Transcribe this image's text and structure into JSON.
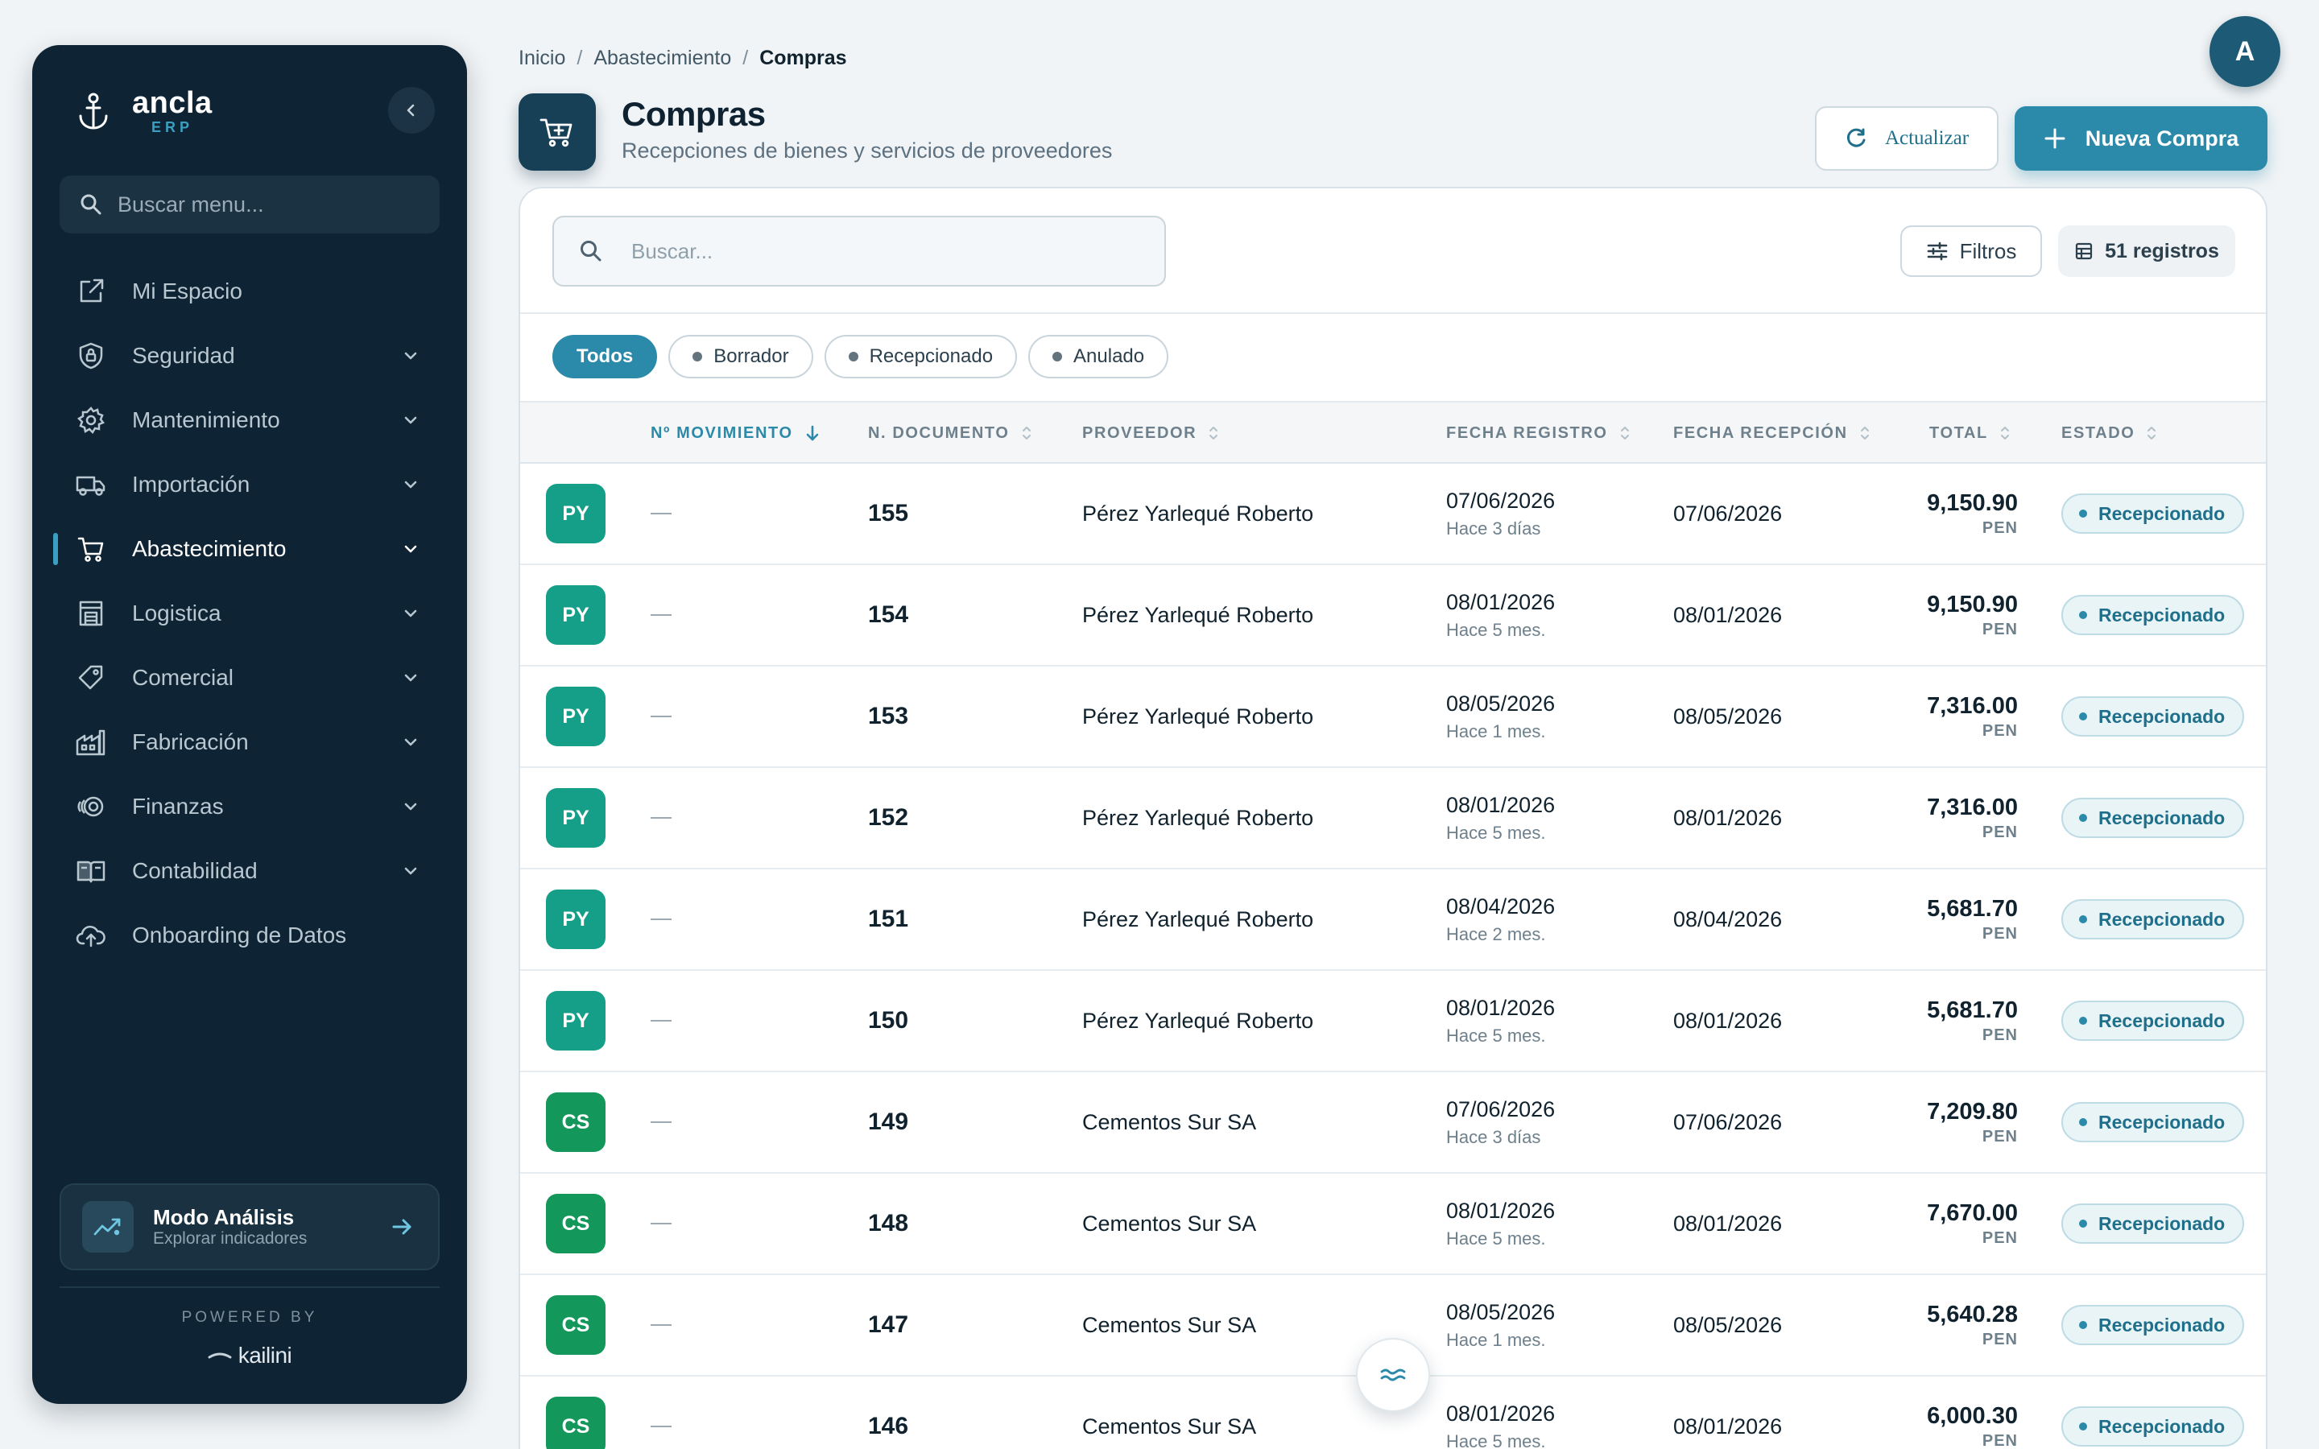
{
  "brand": {
    "name": "ancla",
    "sub": "ERP"
  },
  "sidebar": {
    "search_placeholder": "Buscar menu...",
    "items": [
      {
        "label": "Mi Espacio",
        "icon": "external-link-icon",
        "has_children": false,
        "active": false
      },
      {
        "label": "Seguridad",
        "icon": "shield-icon",
        "has_children": true,
        "active": false
      },
      {
        "label": "Mantenimiento",
        "icon": "gear-icon",
        "has_children": true,
        "active": false
      },
      {
        "label": "Importación",
        "icon": "truck-icon",
        "has_children": true,
        "active": false
      },
      {
        "label": "Abastecimiento",
        "icon": "cart-icon",
        "has_children": true,
        "active": true
      },
      {
        "label": "Logistica",
        "icon": "warehouse-icon",
        "has_children": true,
        "active": false
      },
      {
        "label": "Comercial",
        "icon": "tag-icon",
        "has_children": true,
        "active": false
      },
      {
        "label": "Fabricación",
        "icon": "factory-icon",
        "has_children": true,
        "active": false
      },
      {
        "label": "Finanzas",
        "icon": "coins-icon",
        "has_children": true,
        "active": false
      },
      {
        "label": "Contabilidad",
        "icon": "book-icon",
        "has_children": true,
        "active": false
      },
      {
        "label": "Onboarding de Datos",
        "icon": "cloud-upload-icon",
        "has_children": false,
        "active": false
      }
    ],
    "mode_card": {
      "title": "Modo Análisis",
      "subtitle": "Explorar indicadores"
    },
    "powered_by": "POWERED BY",
    "powered_brand": "kailini"
  },
  "breadcrumb": [
    "Inicio",
    "Abastecimiento",
    "Compras"
  ],
  "avatar_initial": "A",
  "header": {
    "title": "Compras",
    "subtitle": "Recepciones de bienes y servicios de proveedores",
    "refresh_label": "Actualizar",
    "new_label": "Nueva Compra"
  },
  "toolbar": {
    "search_placeholder": "Buscar...",
    "filters_label": "Filtros",
    "records_label": "51 registros"
  },
  "chips": [
    {
      "label": "Todos",
      "active": true
    },
    {
      "label": "Borrador",
      "active": false
    },
    {
      "label": "Recepcionado",
      "active": false
    },
    {
      "label": "Anulado",
      "active": false
    }
  ],
  "columns": {
    "movimiento": "Nº MOVIMIENTO",
    "documento": "N. DOCUMENTO",
    "proveedor": "PROVEEDOR",
    "fecha_registro": "FECHA REGISTRO",
    "fecha_recepcion": "FECHA RECEPCIÓN",
    "total": "TOTAL",
    "estado": "ESTADO"
  },
  "rows": [
    {
      "initials": "PY",
      "kind": "py",
      "doc": "155",
      "provider": "Pérez Yarlequé Roberto",
      "reg_date": "07/06/2026",
      "reg_ago": "Hace 3 días",
      "rec_date": "07/06/2026",
      "total": "9,150.90",
      "currency": "PEN",
      "status": "Recepcionado"
    },
    {
      "initials": "PY",
      "kind": "py",
      "doc": "154",
      "provider": "Pérez Yarlequé Roberto",
      "reg_date": "08/01/2026",
      "reg_ago": "Hace 5 mes.",
      "rec_date": "08/01/2026",
      "total": "9,150.90",
      "currency": "PEN",
      "status": "Recepcionado"
    },
    {
      "initials": "PY",
      "kind": "py",
      "doc": "153",
      "provider": "Pérez Yarlequé Roberto",
      "reg_date": "08/05/2026",
      "reg_ago": "Hace 1 mes.",
      "rec_date": "08/05/2026",
      "total": "7,316.00",
      "currency": "PEN",
      "status": "Recepcionado"
    },
    {
      "initials": "PY",
      "kind": "py",
      "doc": "152",
      "provider": "Pérez Yarlequé Roberto",
      "reg_date": "08/01/2026",
      "reg_ago": "Hace 5 mes.",
      "rec_date": "08/01/2026",
      "total": "7,316.00",
      "currency": "PEN",
      "status": "Recepcionado"
    },
    {
      "initials": "PY",
      "kind": "py",
      "doc": "151",
      "provider": "Pérez Yarlequé Roberto",
      "reg_date": "08/04/2026",
      "reg_ago": "Hace 2 mes.",
      "rec_date": "08/04/2026",
      "total": "5,681.70",
      "currency": "PEN",
      "status": "Recepcionado"
    },
    {
      "initials": "PY",
      "kind": "py",
      "doc": "150",
      "provider": "Pérez Yarlequé Roberto",
      "reg_date": "08/01/2026",
      "reg_ago": "Hace 5 mes.",
      "rec_date": "08/01/2026",
      "total": "5,681.70",
      "currency": "PEN",
      "status": "Recepcionado"
    },
    {
      "initials": "CS",
      "kind": "cs",
      "doc": "149",
      "provider": "Cementos Sur SA",
      "reg_date": "07/06/2026",
      "reg_ago": "Hace 3 días",
      "rec_date": "07/06/2026",
      "total": "7,209.80",
      "currency": "PEN",
      "status": "Recepcionado"
    },
    {
      "initials": "CS",
      "kind": "cs",
      "doc": "148",
      "provider": "Cementos Sur SA",
      "reg_date": "08/01/2026",
      "reg_ago": "Hace 5 mes.",
      "rec_date": "08/01/2026",
      "total": "7,670.00",
      "currency": "PEN",
      "status": "Recepcionado"
    },
    {
      "initials": "CS",
      "kind": "cs",
      "doc": "147",
      "provider": "Cementos Sur SA",
      "reg_date": "08/05/2026",
      "reg_ago": "Hace 1 mes.",
      "rec_date": "08/05/2026",
      "total": "5,640.28",
      "currency": "PEN",
      "status": "Recepcionado"
    },
    {
      "initials": "CS",
      "kind": "cs",
      "doc": "146",
      "provider": "Cementos Sur SA",
      "reg_date": "08/01/2026",
      "reg_ago": "Hace 5 mes.",
      "rec_date": "08/01/2026",
      "total": "6,000.30",
      "currency": "PEN",
      "status": "Recepcionado"
    }
  ],
  "colors": {
    "sidebar_bg": "#0e2434",
    "accent": "#2b8aa9",
    "badge_py": "#169f88",
    "badge_cs": "#14975a"
  }
}
